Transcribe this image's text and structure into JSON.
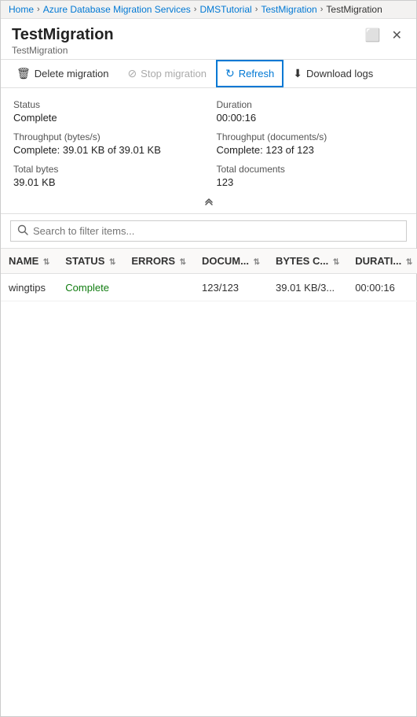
{
  "breadcrumb": {
    "items": [
      {
        "label": "Home",
        "active": true
      },
      {
        "label": "Azure Database Migration Services",
        "active": true
      },
      {
        "label": "DMSTutorial",
        "active": true
      },
      {
        "label": "TestMigration",
        "active": true
      },
      {
        "label": "TestMigration",
        "active": false
      }
    ]
  },
  "header": {
    "title": "TestMigration",
    "subtitle": "TestMigration",
    "window_icon": "⬜",
    "close_icon": "✕"
  },
  "toolbar": {
    "delete_label": "Delete migration",
    "stop_label": "Stop migration",
    "refresh_label": "Refresh",
    "download_label": "Download logs"
  },
  "status": {
    "status_label": "Status",
    "status_value": "Complete",
    "duration_label": "Duration",
    "duration_value": "00:00:16",
    "throughput_bytes_label": "Throughput (bytes/s)",
    "throughput_bytes_value": "Complete: 39.01 KB of 39.01 KB",
    "throughput_docs_label": "Throughput (documents/s)",
    "throughput_docs_value": "Complete: 123 of 123",
    "total_bytes_label": "Total bytes",
    "total_bytes_value": "39.01 KB",
    "total_docs_label": "Total documents",
    "total_docs_value": "123"
  },
  "search": {
    "placeholder": "Search to filter items..."
  },
  "table": {
    "columns": [
      {
        "label": "NAME",
        "key": "name"
      },
      {
        "label": "STATUS",
        "key": "status"
      },
      {
        "label": "ERRORS",
        "key": "errors"
      },
      {
        "label": "DOCUM...",
        "key": "docs"
      },
      {
        "label": "BYTES C...",
        "key": "bytes"
      },
      {
        "label": "DURATI...",
        "key": "duration"
      }
    ],
    "rows": [
      {
        "name": "wingtips",
        "status": "Complete",
        "errors": "",
        "docs": "123/123",
        "bytes": "39.01 KB/3...",
        "duration": "00:00:16"
      }
    ]
  }
}
